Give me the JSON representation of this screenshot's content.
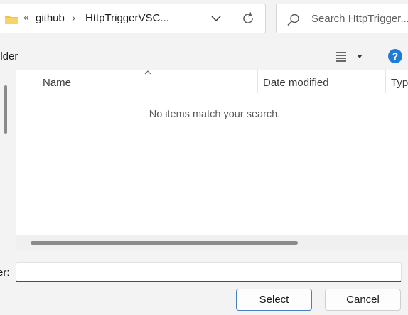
{
  "address_bar": {
    "overflow_glyph": "«",
    "crumbs": [
      "github",
      "HttpTriggerVSC..."
    ],
    "separator": "›"
  },
  "search": {
    "placeholder": "Search HttpTrigger..."
  },
  "command_bar": {
    "new_folder_label": "older"
  },
  "file_list": {
    "columns": [
      "Name",
      "Date modified",
      "Typ"
    ],
    "empty_message": "No items match your search."
  },
  "filename": {
    "label": "er:",
    "value": ""
  },
  "buttons": {
    "select": "Select",
    "cancel": "Cancel"
  },
  "colors": {
    "accent": "#005fb8",
    "help": "#1f7bd6",
    "folder": "#f2c14e"
  }
}
